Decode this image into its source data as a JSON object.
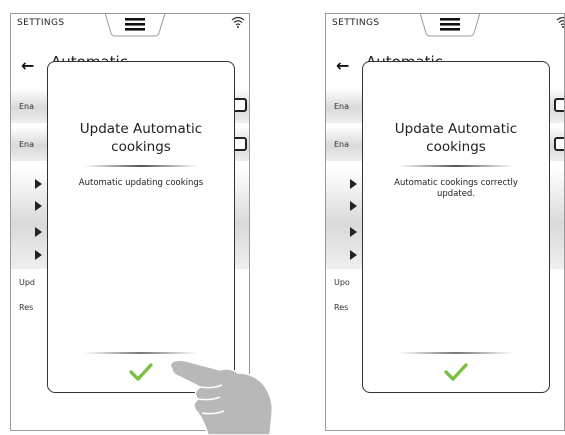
{
  "screens": [
    {
      "topbar": {
        "label": "SETTINGS"
      },
      "background": {
        "title": "Automatic",
        "row_texts": [
          "Ena",
          "Ena",
          "Upd",
          "Res"
        ]
      },
      "dialog": {
        "title": "Update Automatic cookings",
        "message": "Automatic updating cookings"
      }
    },
    {
      "topbar": {
        "label": "SETTINGS"
      },
      "background": {
        "title": "Automatic",
        "row_texts": [
          "Ena",
          "Ena",
          "Upo",
          "Res"
        ]
      },
      "dialog": {
        "title": "Update Automatic cookings",
        "message": "Automatic cookings correctly updated."
      }
    }
  ],
  "icons": {
    "menu": "hamburger-menu-icon",
    "wifi": "wifi-icon",
    "back": "back-arrow-icon",
    "confirm": "check-icon",
    "hand": "pointing-hand-icon"
  },
  "colors": {
    "check": "#7ac143",
    "hand": "#b8b8b8",
    "border": "#9a9a9a"
  }
}
